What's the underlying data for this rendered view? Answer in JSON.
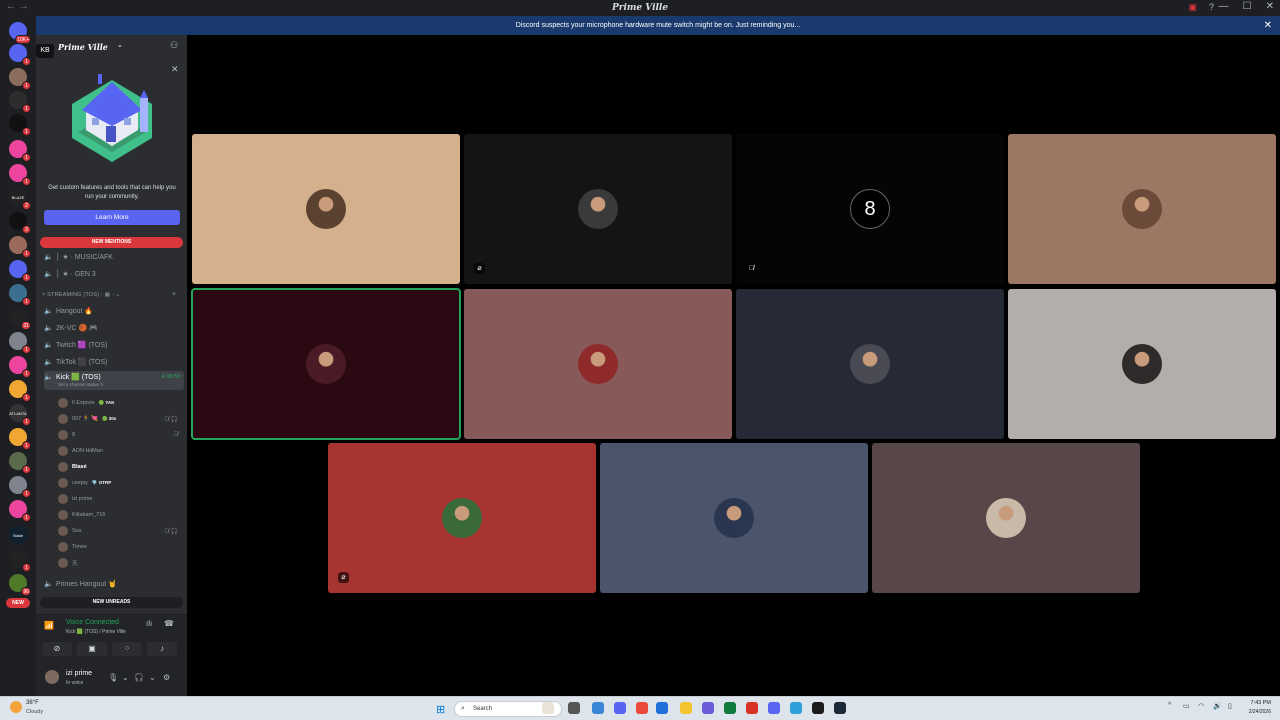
{
  "window": {
    "title": "Prime Ville",
    "nav": "← →",
    "controls": [
      "—",
      "☐",
      "✕"
    ],
    "extra_icons": [
      "inbox-icon",
      "help-icon"
    ]
  },
  "banner": {
    "text": "Discord suspects your microphone hardware mute switch might be on. Just reminding you...",
    "close": "✕"
  },
  "guilds": [
    {
      "label": "",
      "badge": "10K+",
      "color": "#5865f2"
    },
    {
      "label": "",
      "badge": "1",
      "color": "#5865f2"
    },
    {
      "label": "",
      "badge": "1",
      "color": "#8a6d5c"
    },
    {
      "label": "",
      "badge": "1",
      "color": "#2d2d2d"
    },
    {
      "label": "",
      "badge": "1",
      "color": "#111111"
    },
    {
      "label": "",
      "badge": "1",
      "color": "#eb459e"
    },
    {
      "label": "",
      "badge": "1",
      "color": "#eb459e"
    },
    {
      "label": "BLAZE",
      "badge": "2",
      "color": "#222222"
    },
    {
      "label": "",
      "badge": "3",
      "color": "#111111"
    },
    {
      "label": "",
      "badge": "1",
      "color": "#9a6b5c"
    },
    {
      "label": "",
      "badge": "1",
      "color": "#5865f2"
    },
    {
      "label": "",
      "badge": "1",
      "color": "#3c6e8f"
    },
    {
      "label": "",
      "badge": "31",
      "color": "#222222"
    },
    {
      "label": "",
      "badge": "1",
      "color": "#80848e"
    },
    {
      "label": "",
      "badge": "1",
      "color": "#eb459e"
    },
    {
      "label": "",
      "badge": "1",
      "color": "#f0a732"
    },
    {
      "label": "ATLANTA",
      "badge": "1",
      "color": "#333333"
    },
    {
      "label": "",
      "badge": "1",
      "color": "#f0a732"
    },
    {
      "label": "",
      "badge": "1",
      "color": "#5a6a4d"
    },
    {
      "label": "",
      "badge": "1",
      "color": "#80848e"
    },
    {
      "label": "",
      "badge": "1",
      "color": "#eb459e"
    },
    {
      "label": "Stake",
      "badge": "",
      "color": "#0f212e"
    },
    {
      "label": "",
      "badge": "1",
      "color": "#222222"
    },
    {
      "label": "",
      "badge": "96",
      "color": "#4f7a2a"
    }
  ],
  "new_pill": "NEW",
  "kb_label": "KB",
  "sidebar": {
    "server_name": "Prime Ville",
    "chevron": "⌄",
    "promo_text": "Get custom features and tools that can help you run your community.",
    "learn_more": "Learn More",
    "new_mentions": "NEW MENTIONS",
    "channels_top": [
      {
        "name": "│ ★ · MUSIC/AFK"
      },
      {
        "name": "│ ★ · GEN 3"
      }
    ],
    "category": "˅ STREAMING (TOS) · ▦ · ⌄",
    "channels": [
      {
        "name": "Hangout 🔥"
      },
      {
        "name": "2K-VC 🏀 🎮"
      },
      {
        "name": "Twitch 🟪 (TOS)"
      },
      {
        "name": "TikTok ⬛ (TOS)"
      }
    ],
    "active_channel": {
      "name": "Kick 🟩 (TOS)",
      "sub": "Set a channel status ✎",
      "timer": "4:08:59"
    },
    "users": [
      {
        "name": "Il Expoze",
        "tag": "🟢 YAK",
        "bold": false,
        "mute": ""
      },
      {
        "name": "007 🏃 💘",
        "tag": "🟢 30s",
        "bold": false,
        "mute": "🎙̸ 🎧"
      },
      {
        "name": "8",
        "tag": "",
        "bold": false,
        "mute": "🎙̸"
      },
      {
        "name": "AON HitMan",
        "tag": "",
        "bold": false,
        "mute": ""
      },
      {
        "name": "Blasé",
        "tag": "",
        "bold": true,
        "mute": ""
      },
      {
        "name": "ceejay",
        "tag": "💎 OTRP",
        "bold": false,
        "mute": ""
      },
      {
        "name": "izi prime",
        "tag": "",
        "bold": false,
        "mute": ""
      },
      {
        "name": "Kiltakam_716",
        "tag": "",
        "bold": false,
        "mute": ""
      },
      {
        "name": "Sos",
        "tag": "",
        "bold": false,
        "mute": "🎙̸ 🎧"
      },
      {
        "name": "Tonee",
        "tag": "",
        "bold": false,
        "mute": ""
      },
      {
        "name": "天",
        "tag": "",
        "bold": false,
        "mute": ""
      }
    ],
    "last_channel": "Primes Hangout 🤘",
    "new_unreads": "NEW UNREADS"
  },
  "voice": {
    "status": "Voice Connected",
    "location": "Kick 🟩 (TOS) / Prime Ville"
  },
  "user_panel": {
    "name": "izi prime",
    "status": "In voice"
  },
  "tiles": [
    {
      "bg": "#d4b08c",
      "avatar": "#5a4130",
      "ind": "",
      "speaking": false
    },
    {
      "bg": "#141414",
      "avatar": "#3a3a3a",
      "ind": "⌀",
      "speaking": false
    },
    {
      "bg": "#050505",
      "avatar": "#000000",
      "ind": "🎙̸",
      "speaking": false,
      "digit": "8"
    },
    {
      "bg": "#9c7763",
      "avatar": "#6b4a3a",
      "ind": "",
      "speaking": false
    },
    {
      "bg": "#2a0912",
      "avatar": "#4a1a25",
      "ind": "",
      "speaking": true
    },
    {
      "bg": "#875a59",
      "avatar": "#8f2a2a",
      "ind": "",
      "speaking": false
    },
    {
      "bg": "#262a36",
      "avatar": "#4a4a55",
      "ind": "",
      "speaking": false
    },
    {
      "bg": "#b3aeac",
      "avatar": "#2e2b2a",
      "ind": "",
      "speaking": false
    },
    {
      "bg": "#a83432",
      "avatar": "#3a6a3a",
      "ind": "⌀",
      "speaking": false
    },
    {
      "bg": "#4a546a",
      "avatar": "#2a3550",
      "ind": "",
      "speaking": false
    },
    {
      "bg": "#574749",
      "avatar": "#c9b9a8",
      "ind": "",
      "speaking": false
    }
  ],
  "taskbar": {
    "temp": "38°F",
    "condition": "Cloudy",
    "search": "Search",
    "time": "7:43 PM",
    "date": "2/24/2026",
    "apps": [
      "#e9e3d8",
      "#555555",
      "#3a86d6",
      "#5865f2",
      "#e84a3b",
      "#1e6fd9",
      "#f4c431",
      "#6b5bd6",
      "#0f7a3c",
      "#d93025",
      "#5865f2",
      "#2e9fd8",
      "#1b1b1b",
      "#1b2838"
    ]
  }
}
